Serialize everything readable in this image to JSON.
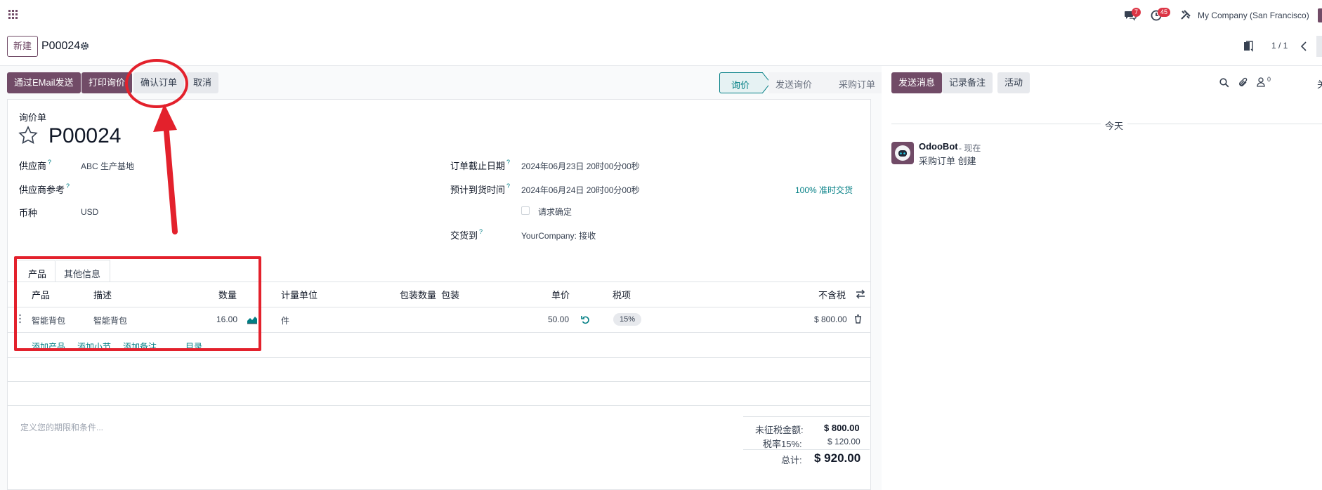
{
  "topbar": {
    "messages_badge": "7",
    "activities_badge": "45",
    "company": "My Company (San Francisco)"
  },
  "control": {
    "new_label": "新建",
    "record_ref": "P00024",
    "pager": "1 / 1"
  },
  "actions": {
    "send_email": "通过EMail发送",
    "print_rfq": "打印询价",
    "confirm_order": "确认订单",
    "cancel": "取消"
  },
  "status": {
    "steps": [
      "询价",
      "发送询价",
      "采购订单"
    ],
    "active": "询价"
  },
  "form": {
    "doc_type": "询价单",
    "name": "P00024",
    "vendor_label": "供应商",
    "vendor_value": "ABC 生产基地",
    "vendor_ref_label": "供应商参考",
    "currency_label": "币种",
    "currency_value": "USD",
    "deadline_label": "订单截止日期",
    "deadline_value": "2024年06月23日 20时00分00秒",
    "expected_label": "预计到货时间",
    "expected_value": "2024年06月24日 20时00分00秒",
    "ontime": "100% 准时交货",
    "ask_confirm_label": "请求确定",
    "deliver_to_label": "交货到",
    "deliver_to_value": "YourCompany: 接收",
    "help_mark": "?"
  },
  "tabs": [
    "产品",
    "其他信息"
  ],
  "table": {
    "headers": {
      "product": "产品",
      "description": "描述",
      "quantity": "数量",
      "uom": "计量单位",
      "pack_qty": "包装数量",
      "packaging": "包装",
      "unit_price": "单价",
      "taxes": "税项",
      "subtotal": "不含税"
    },
    "rows": [
      {
        "product": "智能背包",
        "description": "智能背包",
        "quantity": "16.00",
        "uom": "件",
        "unit_price": "50.00",
        "tax": "15%",
        "subtotal": "$ 800.00"
      }
    ],
    "add_product": "添加产品",
    "add_section": "添加小节",
    "add_note": "添加备注",
    "catalog": "目录"
  },
  "terms_placeholder": "定义您的期限和条件...",
  "totals": {
    "untaxed_label": "未征税金额:",
    "untaxed_value": "$ 800.00",
    "tax_label": "税率15%:",
    "tax_value": "$ 120.00",
    "total_label": "总计:",
    "total_value": "$ 920.00"
  },
  "chatter": {
    "send_message": "发送消息",
    "log_note": "记录备注",
    "activities": "活动",
    "followers_count": "0",
    "today": "今天",
    "author": "OdooBot",
    "time": "- 现在",
    "message": "采购订单 创建",
    "close_partial": "关"
  },
  "colors": {
    "primary": "#714b67",
    "teal": "#017e84",
    "annotation_red": "#e3212c"
  }
}
